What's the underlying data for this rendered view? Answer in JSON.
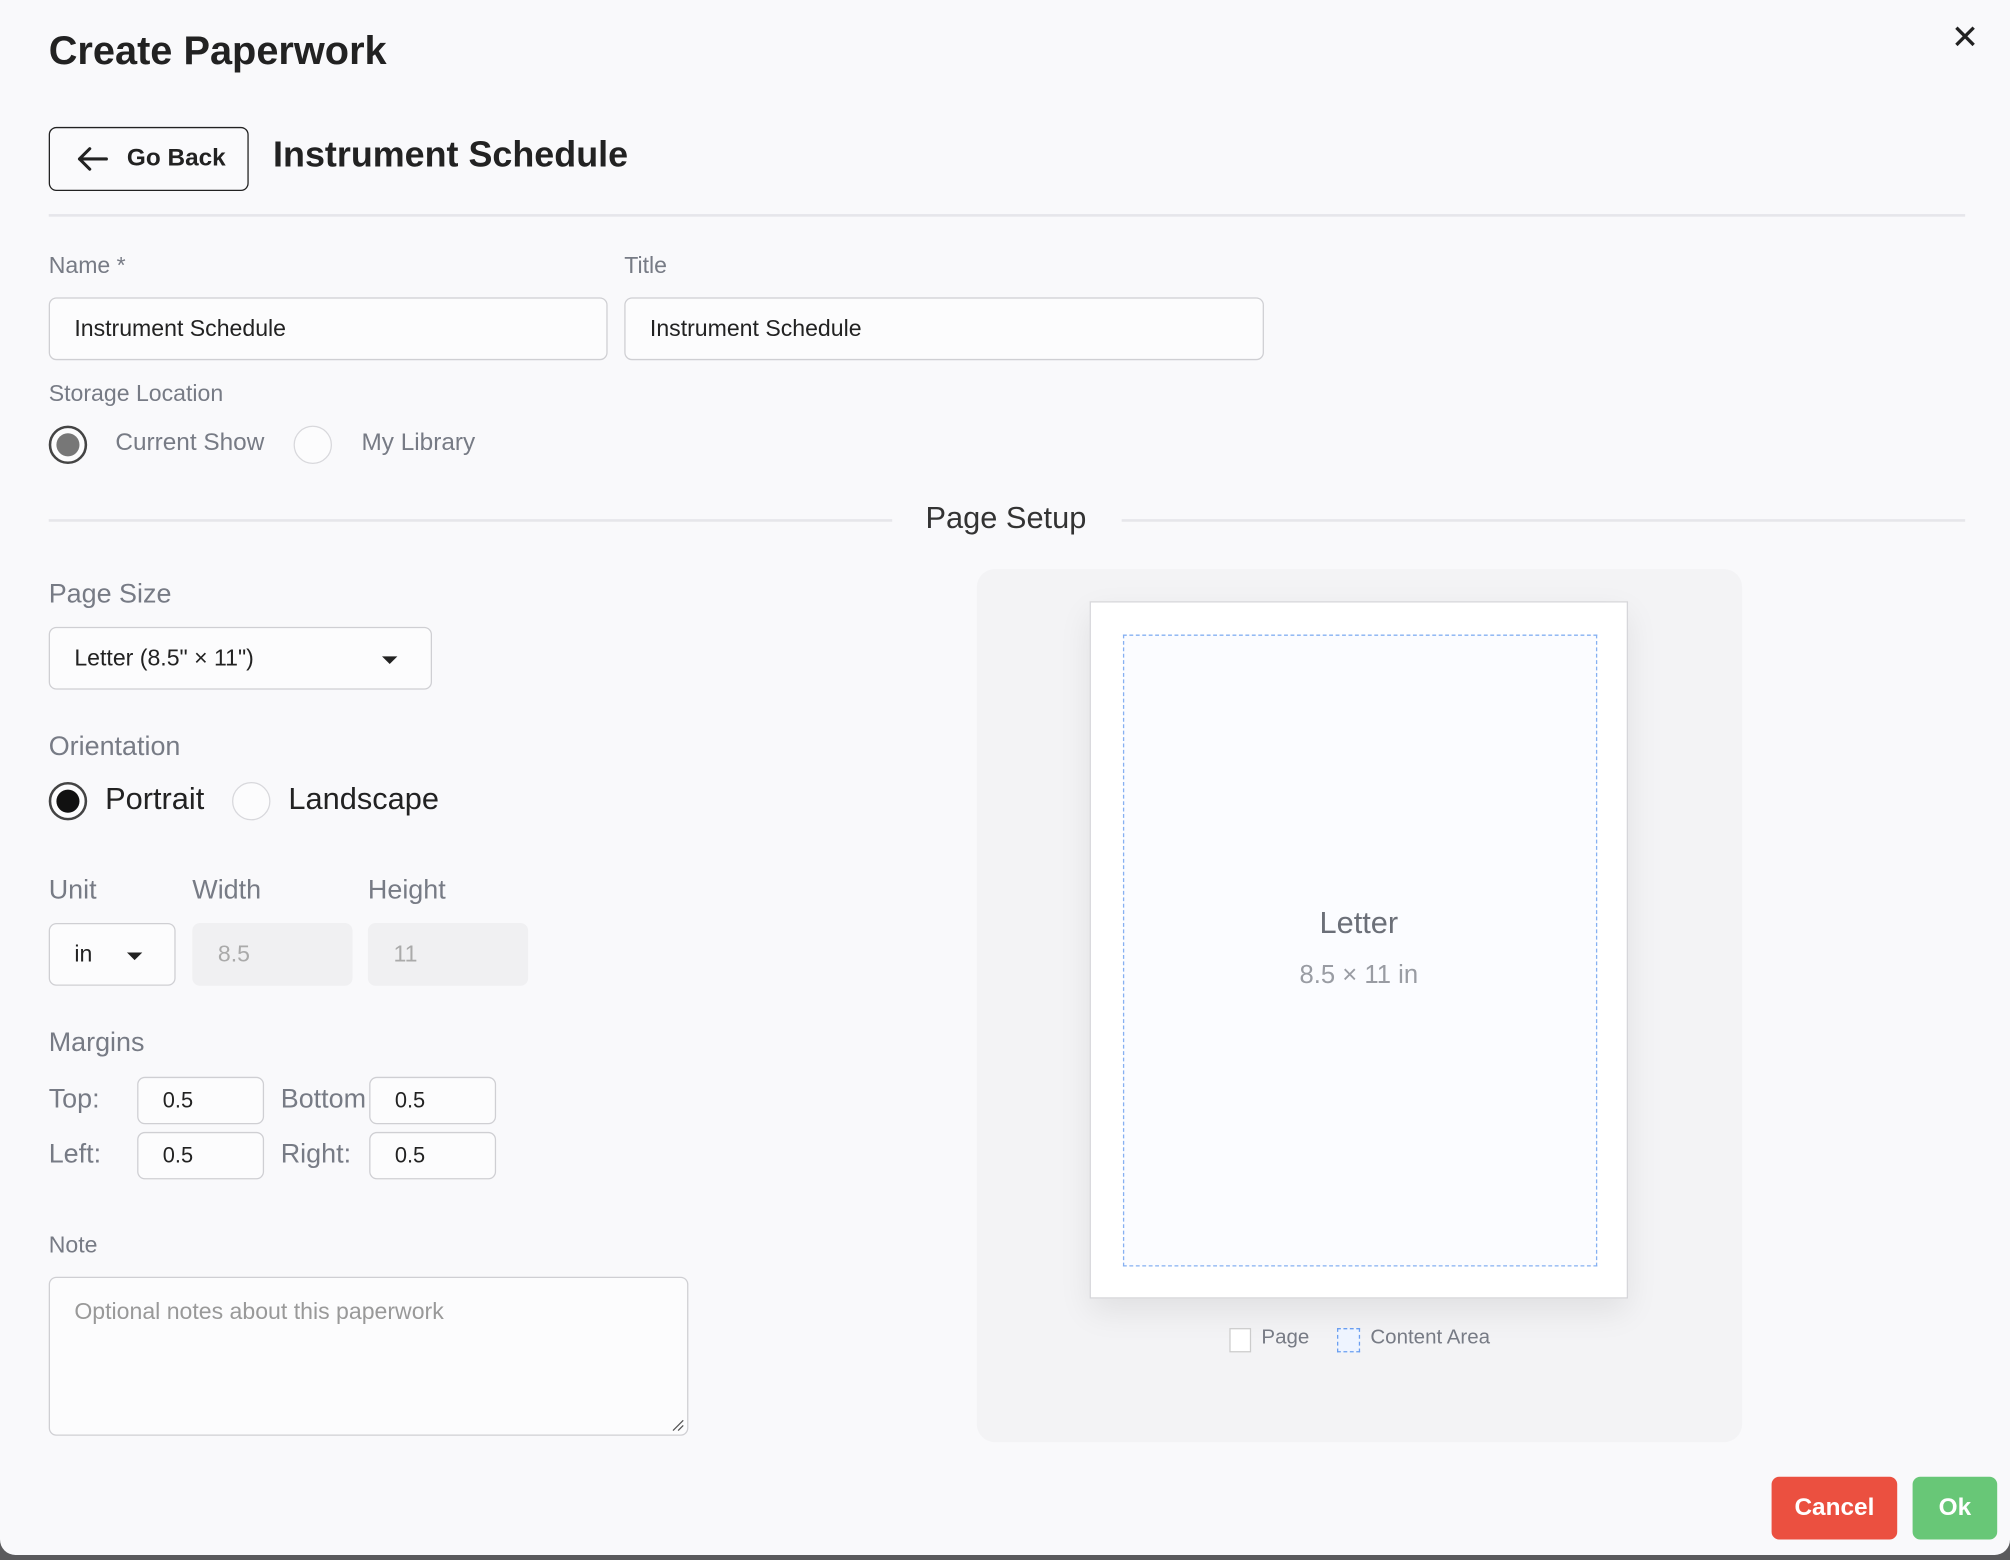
{
  "dialog": {
    "title": "Create Paperwork",
    "close_icon": "close-icon"
  },
  "header": {
    "go_back_label": "Go Back",
    "heading": "Instrument Schedule"
  },
  "form": {
    "name_label": "Name *",
    "name_value": "Instrument Schedule",
    "title_label": "Title",
    "title_value": "Instrument Schedule",
    "storage_label": "Storage Location",
    "storage_options": [
      {
        "label": "Current Show",
        "selected": true
      },
      {
        "label": "My Library",
        "selected": false
      }
    ]
  },
  "page_setup": {
    "section_title": "Page Setup",
    "page_size_label": "Page Size",
    "page_size_value": "Letter (8.5\" × 11\")",
    "orientation_label": "Orientation",
    "orientation_options": [
      {
        "label": "Portrait",
        "selected": true
      },
      {
        "label": "Landscape",
        "selected": false
      }
    ],
    "unit_label": "Unit",
    "unit_value": "in",
    "width_label": "Width",
    "width_value": "8.5",
    "height_label": "Height",
    "height_value": "11",
    "margins_label": "Margins",
    "margins": {
      "top_label": "Top:",
      "top": "0.5",
      "bottom_label": "Bottom",
      "bottom": "0.5",
      "left_label": "Left:",
      "left": "0.5",
      "right_label": "Right:",
      "right": "0.5"
    },
    "note_label": "Note",
    "note_placeholder": "Optional notes about this paperwork"
  },
  "preview": {
    "name": "Letter",
    "dimensions": "8.5 × 11 in",
    "legend_page": "Page",
    "legend_content": "Content Area",
    "content_color": "#86b0f2"
  },
  "footer": {
    "cancel_label": "Cancel",
    "ok_label": "Ok",
    "cancel_color": "#eb5040",
    "ok_color": "#68c777"
  }
}
